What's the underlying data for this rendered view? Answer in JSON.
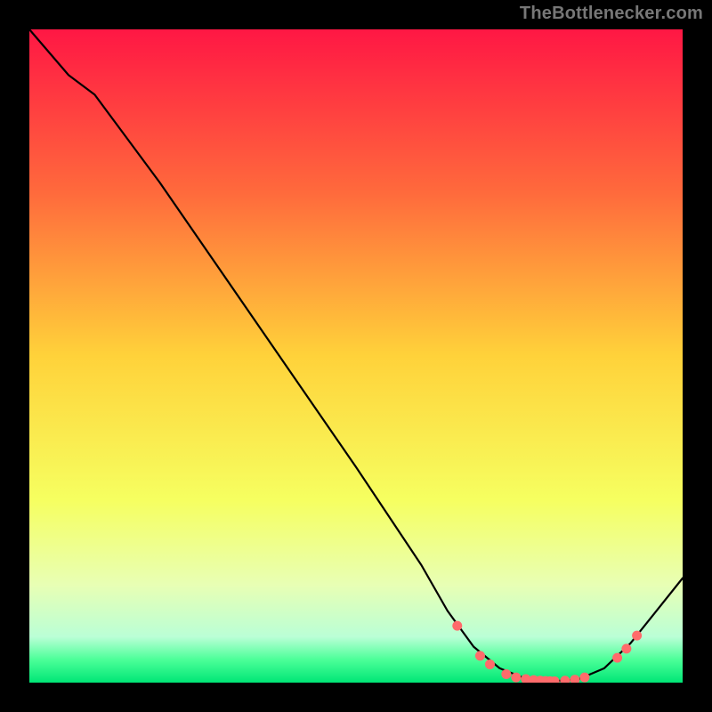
{
  "attribution": "TheBottlenecker.com",
  "chart_data": {
    "type": "line",
    "title": "",
    "xlabel": "",
    "ylabel": "",
    "xlim": [
      0,
      100
    ],
    "ylim": [
      0,
      100
    ],
    "gradient_stops": [
      {
        "pct": 0,
        "color": "#ff1744"
      },
      {
        "pct": 25,
        "color": "#ff6a3c"
      },
      {
        "pct": 50,
        "color": "#ffd23a"
      },
      {
        "pct": 72,
        "color": "#f6ff60"
      },
      {
        "pct": 85,
        "color": "#e8ffb4"
      },
      {
        "pct": 93,
        "color": "#baffd6"
      },
      {
        "pct": 96.5,
        "color": "#4bff98"
      },
      {
        "pct": 100,
        "color": "#00e676"
      }
    ],
    "curve": [
      {
        "x": 0,
        "y": 100
      },
      {
        "x": 6,
        "y": 93
      },
      {
        "x": 10,
        "y": 90
      },
      {
        "x": 20,
        "y": 76.5
      },
      {
        "x": 30,
        "y": 62
      },
      {
        "x": 40,
        "y": 47.5
      },
      {
        "x": 50,
        "y": 33
      },
      {
        "x": 60,
        "y": 18
      },
      {
        "x": 64,
        "y": 11
      },
      {
        "x": 68,
        "y": 5.5
      },
      {
        "x": 72,
        "y": 2.2
      },
      {
        "x": 76,
        "y": 0.6
      },
      {
        "x": 80,
        "y": 0.2
      },
      {
        "x": 84,
        "y": 0.5
      },
      {
        "x": 88,
        "y": 2.2
      },
      {
        "x": 92,
        "y": 6
      },
      {
        "x": 96,
        "y": 11
      },
      {
        "x": 100,
        "y": 16
      }
    ],
    "markers": [
      {
        "x": 65.5,
        "y": 8.7
      },
      {
        "x": 69,
        "y": 4.1
      },
      {
        "x": 70.5,
        "y": 2.8
      },
      {
        "x": 73,
        "y": 1.3
      },
      {
        "x": 74.5,
        "y": 0.8
      },
      {
        "x": 76,
        "y": 0.55
      },
      {
        "x": 77.2,
        "y": 0.4
      },
      {
        "x": 78.2,
        "y": 0.3
      },
      {
        "x": 79,
        "y": 0.25
      },
      {
        "x": 79.7,
        "y": 0.22
      },
      {
        "x": 80.4,
        "y": 0.2
      },
      {
        "x": 82,
        "y": 0.3
      },
      {
        "x": 83.5,
        "y": 0.45
      },
      {
        "x": 85,
        "y": 0.8
      },
      {
        "x": 90,
        "y": 3.8
      },
      {
        "x": 91.4,
        "y": 5.2
      },
      {
        "x": 93,
        "y": 7.2
      }
    ],
    "curve_color": "#000000",
    "curve_width": 2.2,
    "marker_color": "#ff6b6b",
    "marker_radius": 5.5
  }
}
